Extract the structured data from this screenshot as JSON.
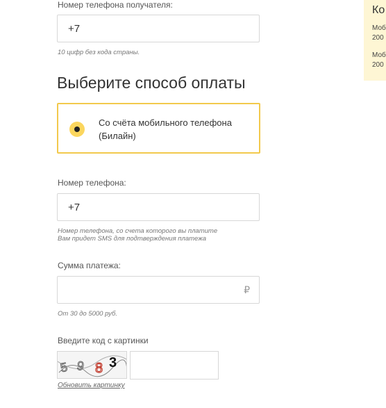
{
  "recipient": {
    "label": "Номер телефона получателя:",
    "value": "+7",
    "hint": "10 цифр без кода страны."
  },
  "payment": {
    "title": "Выберите способ оплаты",
    "option_line1": "Со счёта мобильного телефона",
    "option_line2": "(Билайн)",
    "selected": true
  },
  "phone": {
    "label": "Номер телефона:",
    "value": "+7",
    "hint_line1": "Номер телефона, со счета которого вы платите",
    "hint_line2": "Вам придет SMS для подтверждения платежа"
  },
  "amount": {
    "label": "Сумма платежа:",
    "value": "",
    "currency_symbol": "₽",
    "hint": "От 30 до 5000 руб."
  },
  "captcha": {
    "label": "Введите код с картинки",
    "image_text": "5983",
    "value": "",
    "refresh_label": "Обновить картинку"
  },
  "side_panel": {
    "heading": "Ко",
    "line1a": "Моб",
    "line1b": "200",
    "line2a": "Моб",
    "line2b": "200"
  },
  "colors": {
    "accent_yellow": "#fbd65e",
    "selected_border": "#f2c94c",
    "side_panel_bg": "#fef6d4"
  }
}
